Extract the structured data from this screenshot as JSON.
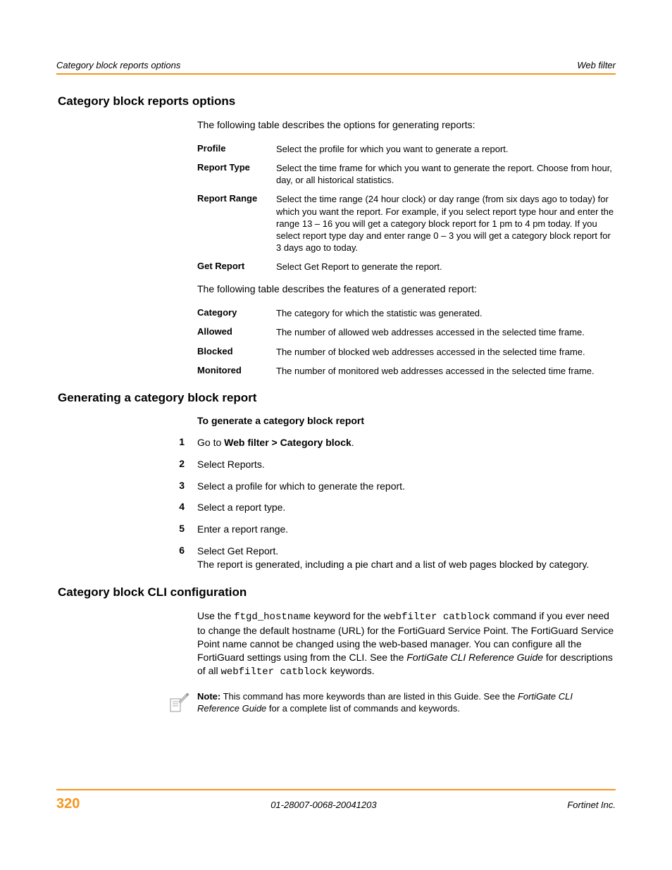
{
  "header": {
    "left": "Category block reports options",
    "right": "Web filter"
  },
  "section1": {
    "title": "Category block reports options",
    "intro": "The following table describes the options for generating reports:",
    "rows": [
      {
        "label": "Profile",
        "desc": "Select the profile for which you want to generate a report."
      },
      {
        "label": "Report Type",
        "desc": "Select the time frame for which you want to generate the report. Choose from hour, day, or all historical statistics."
      },
      {
        "label": "Report Range",
        "desc": "Select the time range (24 hour clock) or day range (from six days ago to today) for which you want the report. For example, if you select report type hour and enter the range 13 – 16 you will get a category block report for 1 pm to 4 pm today. If you select report type day and enter range 0 – 3 you will get a category block report for 3 days ago to today."
      },
      {
        "label": "Get Report",
        "desc": "Select Get Report to generate the report."
      }
    ],
    "intro2": "The following table describes the features of a generated report:",
    "rows2": [
      {
        "label": "Category",
        "desc": "The category for which the statistic was generated."
      },
      {
        "label": "Allowed",
        "desc": "The number of allowed web addresses accessed in the selected time frame."
      },
      {
        "label": "Blocked",
        "desc": "The number of blocked web addresses accessed in the selected time frame."
      },
      {
        "label": "Monitored",
        "desc": "The number of monitored web addresses accessed in the selected time frame."
      }
    ]
  },
  "section2": {
    "title": "Generating a category block report",
    "proc_heading": "To generate a category block report",
    "steps": [
      {
        "n": "1",
        "pre": "Go to ",
        "bold": "Web filter > Category block",
        "post": "."
      },
      {
        "n": "2",
        "text": "Select Reports."
      },
      {
        "n": "3",
        "text": "Select a profile for which to generate the report."
      },
      {
        "n": "4",
        "text": "Select a report type."
      },
      {
        "n": "5",
        "text": "Enter a report range."
      },
      {
        "n": "6",
        "text": "Select Get Report.",
        "extra": "The report is generated, including a pie chart and a list of web pages blocked by category."
      }
    ]
  },
  "section3": {
    "title": "Category block CLI configuration",
    "para": {
      "p1": "Use the ",
      "c1": "ftgd_hostname",
      "p2": " keyword for the ",
      "c2": "webfilter catblock",
      "p3": " command if you ever need to change the default hostname (URL) for the FortiGuard Service Point. The FortiGuard Service Point name cannot be changed using the web-based manager. You can configure all the FortiGuard settings using from the CLI. See the ",
      "i1": "FortiGate CLI Reference Guide",
      "p4": " for descriptions of all ",
      "c3": "webfilter catblock",
      "p5": " keywords."
    },
    "note": {
      "label": "Note:",
      "p1": " This command has more keywords than are listed in this Guide. See the ",
      "i1": "FortiGate CLI Reference Guide",
      "p2": " for a complete list of commands and keywords."
    }
  },
  "footer": {
    "page": "320",
    "docid": "01-28007-0068-20041203",
    "company": "Fortinet Inc."
  }
}
